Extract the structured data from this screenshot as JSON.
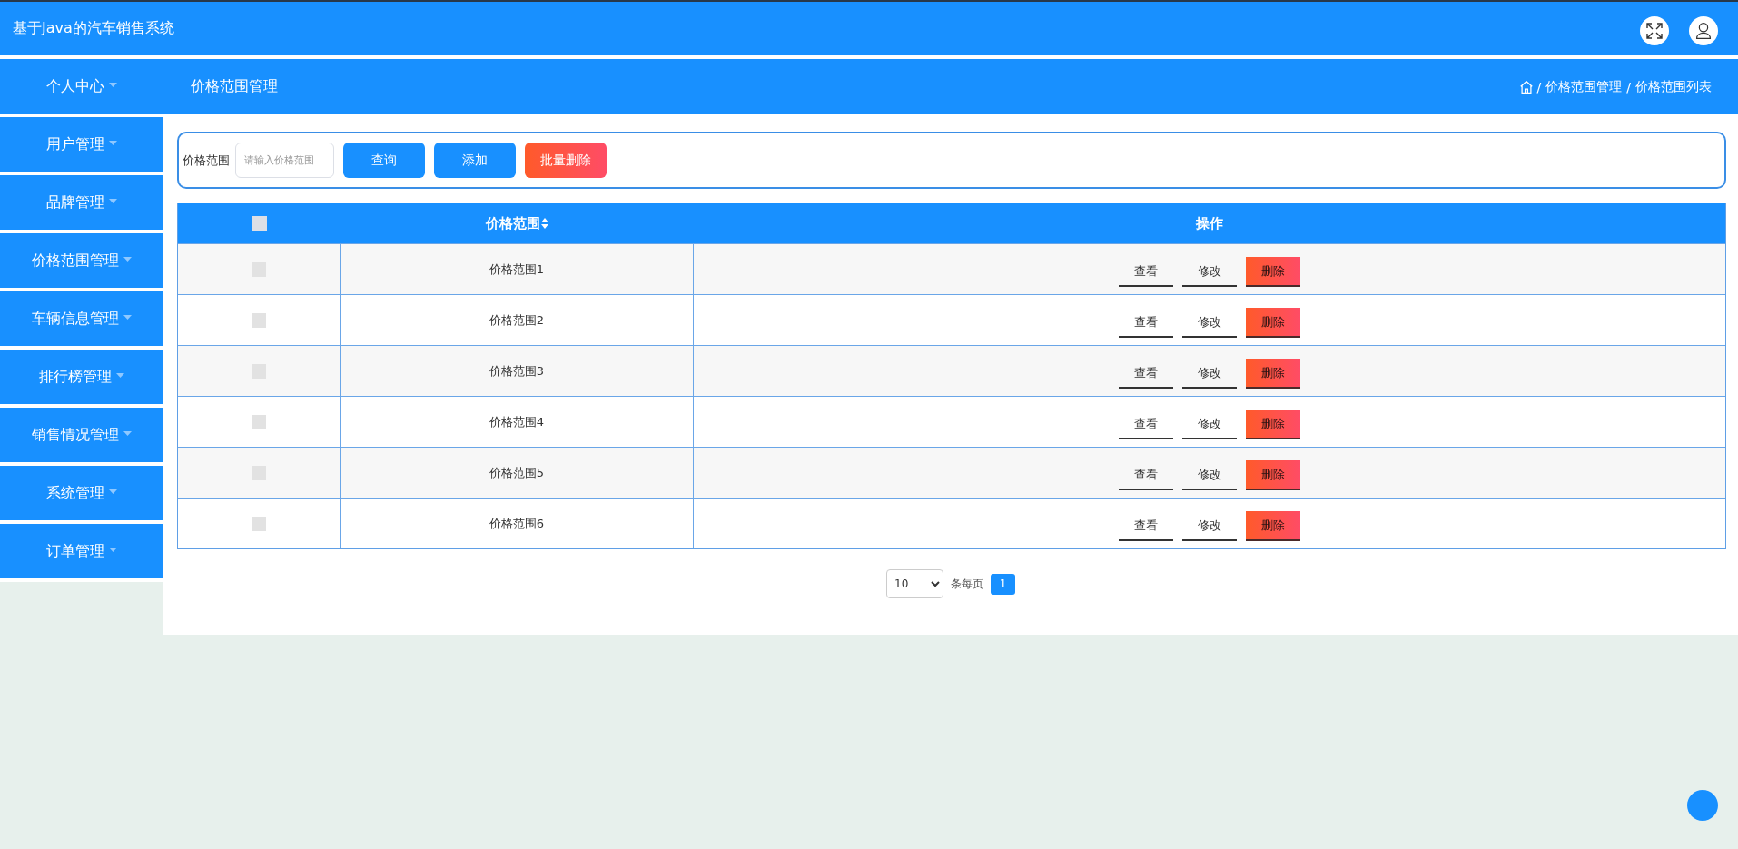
{
  "header": {
    "title": "基于Java的汽车销售系统"
  },
  "sidebar": {
    "items": [
      {
        "label": "个人中心"
      },
      {
        "label": "用户管理"
      },
      {
        "label": "品牌管理"
      },
      {
        "label": "价格范围管理"
      },
      {
        "label": "车辆信息管理"
      },
      {
        "label": "排行榜管理"
      },
      {
        "label": "销售情况管理"
      },
      {
        "label": "系统管理"
      },
      {
        "label": "订单管理"
      }
    ]
  },
  "page_bar": {
    "title": "价格范围管理",
    "breadcrumb": [
      {
        "kind": "home"
      },
      {
        "kind": "separator",
        "text": "/"
      },
      {
        "kind": "link",
        "text": "价格范围管理"
      },
      {
        "kind": "separator",
        "text": "/"
      },
      {
        "kind": "current",
        "text": "价格范围列表"
      }
    ]
  },
  "search": {
    "label": "价格范围",
    "placeholder": "请输入价格范围",
    "buttons": [
      {
        "label": "查询",
        "kind": "primary"
      },
      {
        "label": "添加",
        "kind": "primary"
      },
      {
        "label": "批量删除",
        "kind": "danger"
      }
    ]
  },
  "table": {
    "columns": [
      {
        "kind": "checkbox",
        "checked": false
      },
      {
        "kind": "text",
        "label": "价格范围",
        "sortable": true
      },
      {
        "kind": "actions",
        "label": "操作"
      }
    ],
    "rows": [
      {
        "checked": false,
        "name": "价格范围1",
        "actions": [
          {
            "label": "查看",
            "kind": "plain"
          },
          {
            "label": "修改",
            "kind": "plain"
          },
          {
            "label": "删除",
            "kind": "danger"
          }
        ]
      },
      {
        "checked": false,
        "name": "价格范围2",
        "actions": [
          {
            "label": "查看",
            "kind": "plain"
          },
          {
            "label": "修改",
            "kind": "plain"
          },
          {
            "label": "删除",
            "kind": "danger"
          }
        ]
      },
      {
        "checked": false,
        "name": "价格范围3",
        "actions": [
          {
            "label": "查看",
            "kind": "plain"
          },
          {
            "label": "修改",
            "kind": "plain"
          },
          {
            "label": "删除",
            "kind": "danger"
          }
        ]
      },
      {
        "checked": false,
        "name": "价格范围4",
        "actions": [
          {
            "label": "查看",
            "kind": "plain"
          },
          {
            "label": "修改",
            "kind": "plain"
          },
          {
            "label": "删除",
            "kind": "danger"
          }
        ]
      },
      {
        "checked": false,
        "name": "价格范围5",
        "actions": [
          {
            "label": "查看",
            "kind": "plain"
          },
          {
            "label": "修改",
            "kind": "plain"
          },
          {
            "label": "删除",
            "kind": "danger"
          }
        ]
      },
      {
        "checked": false,
        "name": "价格范围6",
        "actions": [
          {
            "label": "查看",
            "kind": "plain"
          },
          {
            "label": "修改",
            "kind": "plain"
          },
          {
            "label": "删除",
            "kind": "danger"
          }
        ]
      }
    ]
  },
  "pagination": {
    "page_size": "10",
    "size_label": "条每页",
    "pages": [
      {
        "label": "1",
        "selected": true
      }
    ]
  }
}
